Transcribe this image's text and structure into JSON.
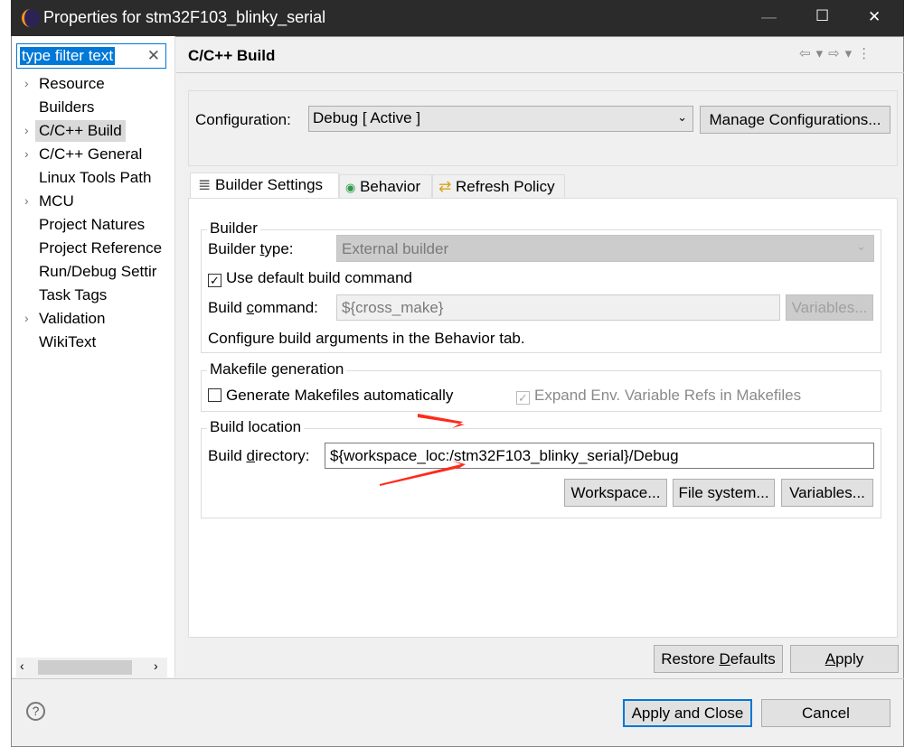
{
  "window": {
    "title": "Properties for stm32F103_blinky_serial",
    "minimize": "—",
    "maximize": "☐",
    "close": "✕"
  },
  "sidebar": {
    "filter_value": "type filter text",
    "items": [
      {
        "label": "Resource",
        "expandable": true
      },
      {
        "label": "Builders",
        "expandable": false
      },
      {
        "label": "C/C++ Build",
        "expandable": true,
        "selected": true
      },
      {
        "label": "C/C++ General",
        "expandable": true
      },
      {
        "label": "Linux Tools Path",
        "expandable": false
      },
      {
        "label": "MCU",
        "expandable": true
      },
      {
        "label": "Project Natures",
        "expandable": false
      },
      {
        "label": "Project Reference",
        "expandable": false
      },
      {
        "label": "Run/Debug Settir",
        "expandable": false
      },
      {
        "label": "Task Tags",
        "expandable": false
      },
      {
        "label": "Validation",
        "expandable": true
      },
      {
        "label": "WikiText",
        "expandable": false
      }
    ]
  },
  "header": {
    "title": "C/C++ Build"
  },
  "config": {
    "label": "Configuration:",
    "value": "Debug  [ Active ]",
    "manage": "Manage Configurations..."
  },
  "tabs": [
    {
      "label": "Builder Settings",
      "icon": "list-icon"
    },
    {
      "label": "Behavior",
      "icon": "radio-icon"
    },
    {
      "label": "Refresh Policy",
      "icon": "refresh-icon"
    }
  ],
  "builder": {
    "group": "Builder",
    "type_label": "Builder type:",
    "type_value": "External builder",
    "use_default": "Use default build command",
    "use_default_checked": true,
    "cmd_label": "Build command:",
    "cmd_value": "${cross_make}",
    "variables": "Variables...",
    "note": "Configure build arguments in the Behavior tab."
  },
  "makefile": {
    "group": "Makefile generation",
    "generate": "Generate Makefiles automatically",
    "generate_checked": false,
    "expand": "Expand Env. Variable Refs in Makefiles",
    "expand_checked": true
  },
  "location": {
    "group": "Build location",
    "dir_label": "Build directory:",
    "dir_value": "${workspace_loc:/stm32F103_blinky_serial}/Debug",
    "workspace": "Workspace...",
    "filesystem": "File system...",
    "variables": "Variables..."
  },
  "footer": {
    "restore": "Restore Defaults",
    "apply": "Apply",
    "apply_close": "Apply and Close",
    "cancel": "Cancel",
    "help": "?"
  },
  "colors": {
    "titlebar": "#2b2b2b",
    "selection": "#0078d7",
    "arrow": "#ff2a1a"
  }
}
